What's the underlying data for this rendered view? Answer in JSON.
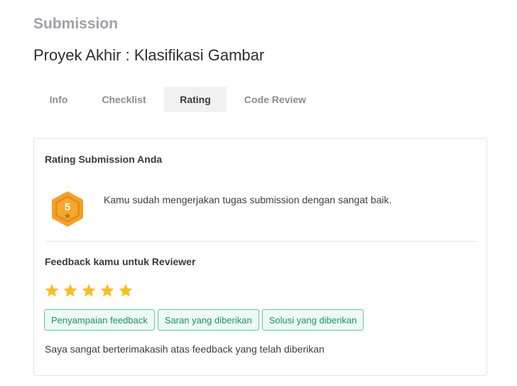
{
  "header": {
    "section": "Submission",
    "title": "Proyek Akhir : Klasifikasi Gambar"
  },
  "tabs": [
    {
      "label": "Info",
      "active": false
    },
    {
      "label": "Checklist",
      "active": false
    },
    {
      "label": "Rating",
      "active": true
    },
    {
      "label": "Code Review",
      "active": false
    }
  ],
  "rating": {
    "heading": "Rating Submission Anda",
    "badge_value": "5",
    "badge_icon": "hexagon-star-badge-icon",
    "message": "Kamu sudah mengerjakan tugas submission dengan sangat baik."
  },
  "feedback": {
    "heading": "Feedback kamu untuk Reviewer",
    "stars_value": 5,
    "stars_max": 5,
    "tags": [
      "Penyampaian feedback",
      "Saran yang diberikan",
      "Solusi yang diberikan"
    ],
    "text": "Saya sangat berterimakasih atas feedback yang telah diberikan"
  },
  "colors": {
    "star": "#f7bf1e",
    "badge_outer": "#f3a12a",
    "badge_inner": "#e88a14",
    "tag_text": "#17965f",
    "tag_border": "#5fcb9a",
    "tag_bg": "#eefaf4"
  }
}
